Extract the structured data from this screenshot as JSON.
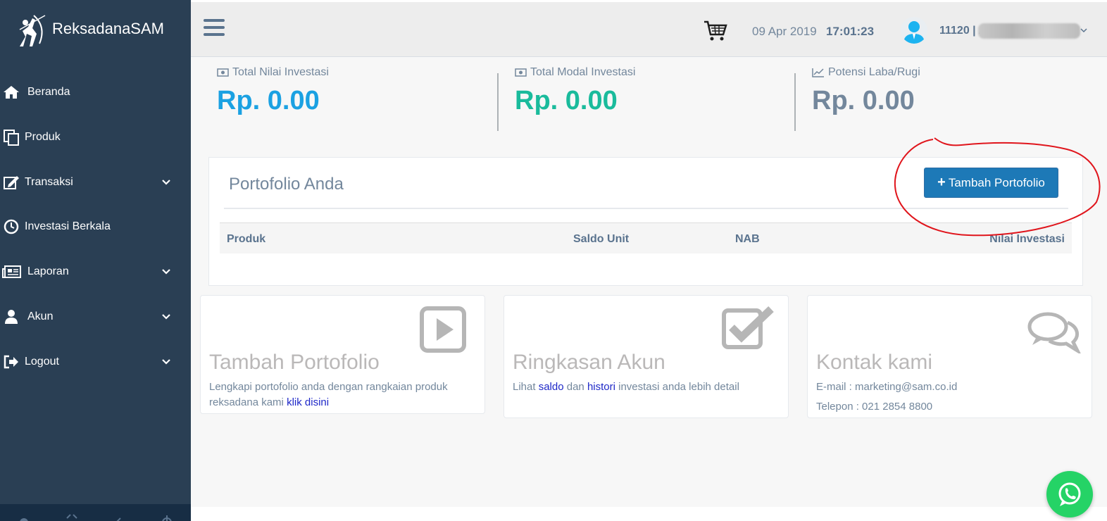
{
  "brand": {
    "name": "ReksadanaSAM"
  },
  "sidebar": {
    "items": [
      {
        "label": "Beranda",
        "icon": "home-icon"
      },
      {
        "label": "Produk",
        "icon": "copy-icon"
      },
      {
        "label": "Transaksi",
        "icon": "edit-icon",
        "has_submenu": true
      },
      {
        "label": "Investasi Berkala",
        "icon": "clock-icon"
      },
      {
        "label": "Laporan",
        "icon": "newspaper-icon",
        "has_submenu": true
      },
      {
        "label": "Akun",
        "icon": "user-icon",
        "has_submenu": true
      },
      {
        "label": "Logout",
        "icon": "sign-out-icon",
        "has_submenu": true
      }
    ],
    "footer_icons": [
      "settings-icon",
      "fullscreen-icon",
      "compress-icon",
      "power-icon"
    ]
  },
  "topbar": {
    "date": "09 Apr 2019",
    "time": "17:01:23",
    "user_id": "11120 | A"
  },
  "stats": [
    {
      "title": "Total Nilai Investasi",
      "value": "Rp. 0.00",
      "color": "#1ba1e2"
    },
    {
      "title": "Total Modal Investasi",
      "value": "Rp. 0.00",
      "color": "#1abb9c"
    },
    {
      "title": "Potensi Laba/Rugi",
      "value": "Rp. 0.00",
      "color": "#73879c"
    }
  ],
  "portfolio": {
    "title": "Portofolio Anda",
    "add_button": "Tambah Portofolio",
    "columns": [
      "Produk",
      "Saldo Unit",
      "NAB",
      "Nilai Investasi"
    ]
  },
  "boxes": {
    "add": {
      "title": "Tambah Portofolio",
      "text1": "Lengkapi portofolio anda dengan rangkaian produk reksadana kami ",
      "link": "klik disini"
    },
    "summary": {
      "title": "Ringkasan Akun",
      "t1": "Lihat ",
      "link1": "saldo",
      "t2": " dan ",
      "link2": "histori",
      "t3": " investasi anda lebih detail"
    },
    "contact": {
      "title": "Kontak kami",
      "email": "E-mail : marketing@sam.co.id",
      "phone": "Telepon : 021 2854 8800"
    }
  },
  "colors": {
    "sidebar": "#2a3f54",
    "primary_button": "#1d79b7",
    "annotation": "#e0151c"
  }
}
